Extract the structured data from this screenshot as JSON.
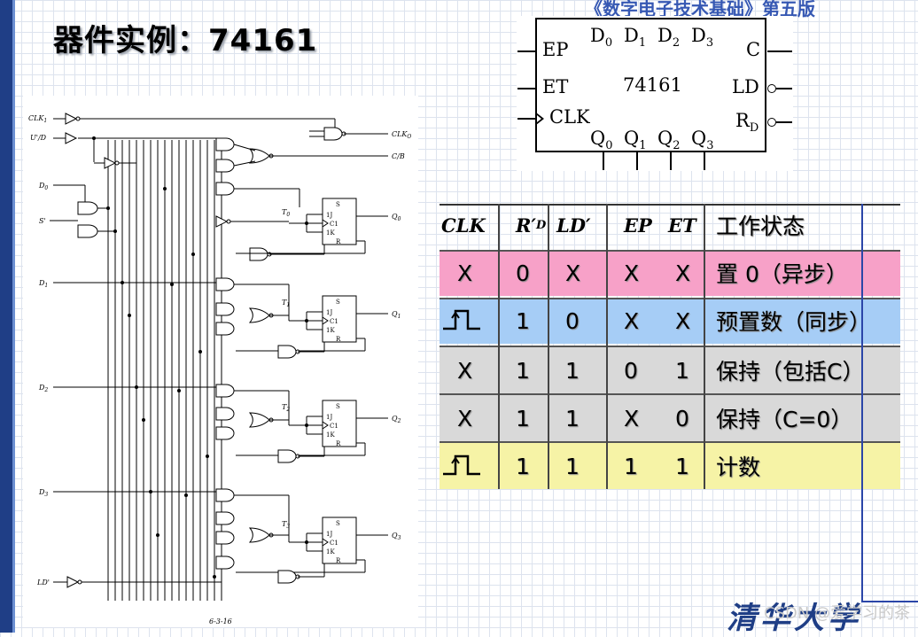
{
  "page": {
    "banner": "《数字电子技术基础》第五版",
    "title": "器件实例：74161"
  },
  "chip": {
    "name": "74161",
    "left_pins": [
      "EP",
      "ET",
      "CLK"
    ],
    "right_pins": [
      "C",
      "LD",
      "R"
    ],
    "right_pin_sub_rd": "D",
    "top_pins": [
      {
        "base": "D",
        "sub": "0"
      },
      {
        "base": "D",
        "sub": "1"
      },
      {
        "base": "D",
        "sub": "2"
      },
      {
        "base": "D",
        "sub": "3"
      }
    ],
    "bottom_pins": [
      {
        "base": "Q",
        "sub": "0"
      },
      {
        "base": "Q",
        "sub": "1"
      },
      {
        "base": "Q",
        "sub": "2"
      },
      {
        "base": "Q",
        "sub": "3"
      }
    ]
  },
  "schematic": {
    "inputs": {
      "clk1": "CLK",
      "clk1_sub": "1",
      "ud": "U'/D",
      "d0": "D",
      "d0_sub": "0",
      "s": "S'",
      "d1": "D",
      "d1_sub": "1",
      "d2": "D",
      "d2_sub": "2",
      "d3": "D",
      "d3_sub": "3",
      "ld": "LD'"
    },
    "outputs": {
      "clko": "CLK",
      "clko_sub": "O",
      "cb": "C/B"
    },
    "t_labels": [
      {
        "base": "T",
        "sub": "0"
      },
      {
        "base": "T",
        "sub": "1"
      },
      {
        "base": "T",
        "sub": "2"
      },
      {
        "base": "T",
        "sub": "3"
      }
    ],
    "q_labels": [
      {
        "base": "Q",
        "sub": "0"
      },
      {
        "base": "Q",
        "sub": "1"
      },
      {
        "base": "Q",
        "sub": "2"
      },
      {
        "base": "Q",
        "sub": "3"
      }
    ],
    "ff_pins": [
      "S",
      "1J",
      "C1",
      "1K",
      "R"
    ],
    "figure_number": "6-3-16"
  },
  "truth_table": {
    "headers": {
      "clk": "CLK",
      "rd": "R′",
      "rd_sub": "D",
      "ld": "LD′",
      "ep": "EP",
      "et": "ET",
      "state": "工作状态"
    },
    "rows": [
      {
        "clk": "X",
        "clk_is_pulse": false,
        "rd": "0",
        "ld": "X",
        "ep": "X",
        "et": "X",
        "state": "置 0（异步）",
        "bg": "#f7a1c8"
      },
      {
        "clk": "",
        "clk_is_pulse": true,
        "rd": "1",
        "ld": "0",
        "ep": "X",
        "et": "X",
        "state": "预置数（同步）",
        "bg": "#a6cdf6"
      },
      {
        "clk": "X",
        "clk_is_pulse": false,
        "rd": "1",
        "ld": "1",
        "ep": "0",
        "et": "1",
        "state": "保持（包括C）",
        "bg": "#d9d9d9"
      },
      {
        "clk": "X",
        "clk_is_pulse": false,
        "rd": "1",
        "ld": "1",
        "ep": "X",
        "et": "0",
        "state": "保持（C=0）",
        "bg": "#d9d9d9"
      },
      {
        "clk": "",
        "clk_is_pulse": true,
        "rd": "1",
        "ld": "1",
        "ep": "1",
        "et": "1",
        "state": "计数",
        "bg": "#f6f3a6"
      }
    ]
  },
  "footer": {
    "logo": "清华大学",
    "watermark": "CSDN @爱学习的茶"
  }
}
